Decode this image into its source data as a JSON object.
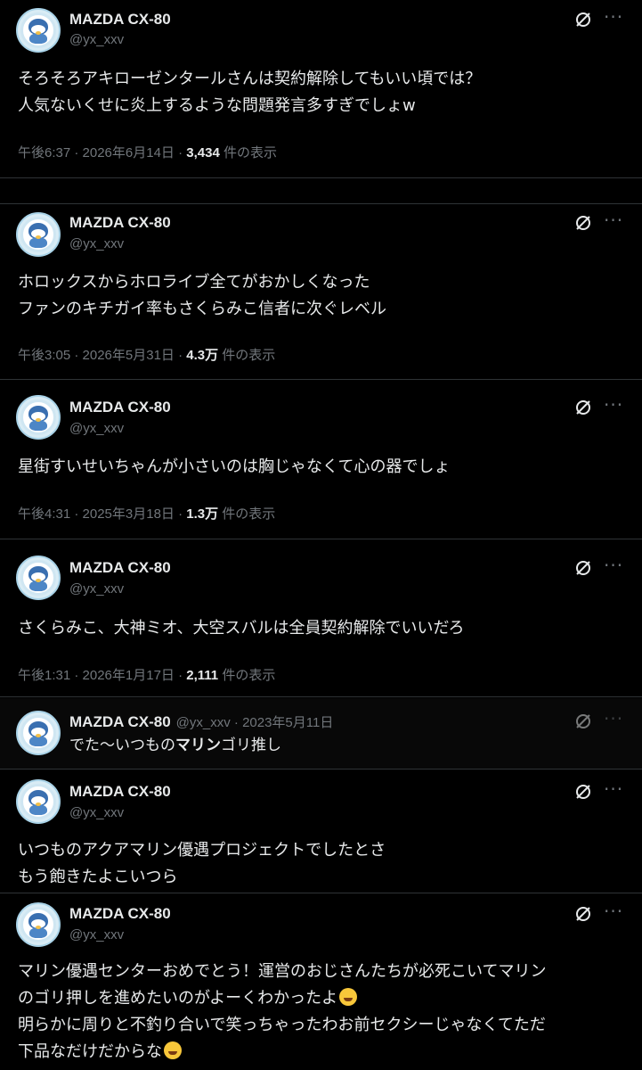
{
  "author": {
    "name": "MAZDA CX-80",
    "handle": "@yx_xxv"
  },
  "tweets": [
    {
      "lines": [
        "そろそろアキローゼンタールさんは契約解除してもいい頃では？",
        "人気ないくせに炎上するような問題発言多すぎでしょw"
      ],
      "time": "午後6:37 · 2026年6月14日 · ",
      "views": "3,434",
      "views_suffix": " 件の表示"
    },
    {
      "lines": [
        "ホロックスからホロライブ全てがおかしくなった",
        "ファンのキチガイ率もさくらみこ信者に次ぐレベル"
      ],
      "time": "午後3:05 · 2026年5月31日 · ",
      "views": "4.3万",
      "views_suffix": " 件の表示"
    },
    {
      "lines": [
        "星街すいせいちゃんが小さいのは胸じゃなくて心の器でしょ"
      ],
      "time": "午後4:31 · 2025年3月18日 · ",
      "views": "1.3万",
      "views_suffix": " 件の表示"
    },
    {
      "lines": [
        "さくらみこ、大神ミオ、大空スバルは全員契約解除でいいだろ"
      ],
      "time": "午後1:31 · 2026年1月17日 · ",
      "views": "2,111",
      "views_suffix": " 件の表示"
    },
    {
      "inline_meta": " · 2023年5月11日",
      "text_pre": "でた〜いつもの",
      "text_bold": "マリン",
      "text_post": "ゴリ推し"
    },
    {
      "lines": [
        "いつものアクアマリン優遇プロジェクトでしたとさ",
        "もう飽きたよこいつら"
      ]
    },
    {
      "lines": [
        "マリン優遇センターおめでとう！運営のおじさんたちが必死こいてマリン",
        "のゴリ押しを進めたいのがよーくわかったよ",
        "明らかに周りと不釣り合いで笑っちゃったわお前セクシーじゃなくてただ",
        "下品なだけだからな"
      ],
      "emoji": [
        "grinning-sweat-emoji",
        "tears-of-joy-emoji"
      ]
    }
  ],
  "icons": {
    "grok": "grok-icon",
    "more": "more-icon",
    "avatar": "penguin-avatar"
  }
}
